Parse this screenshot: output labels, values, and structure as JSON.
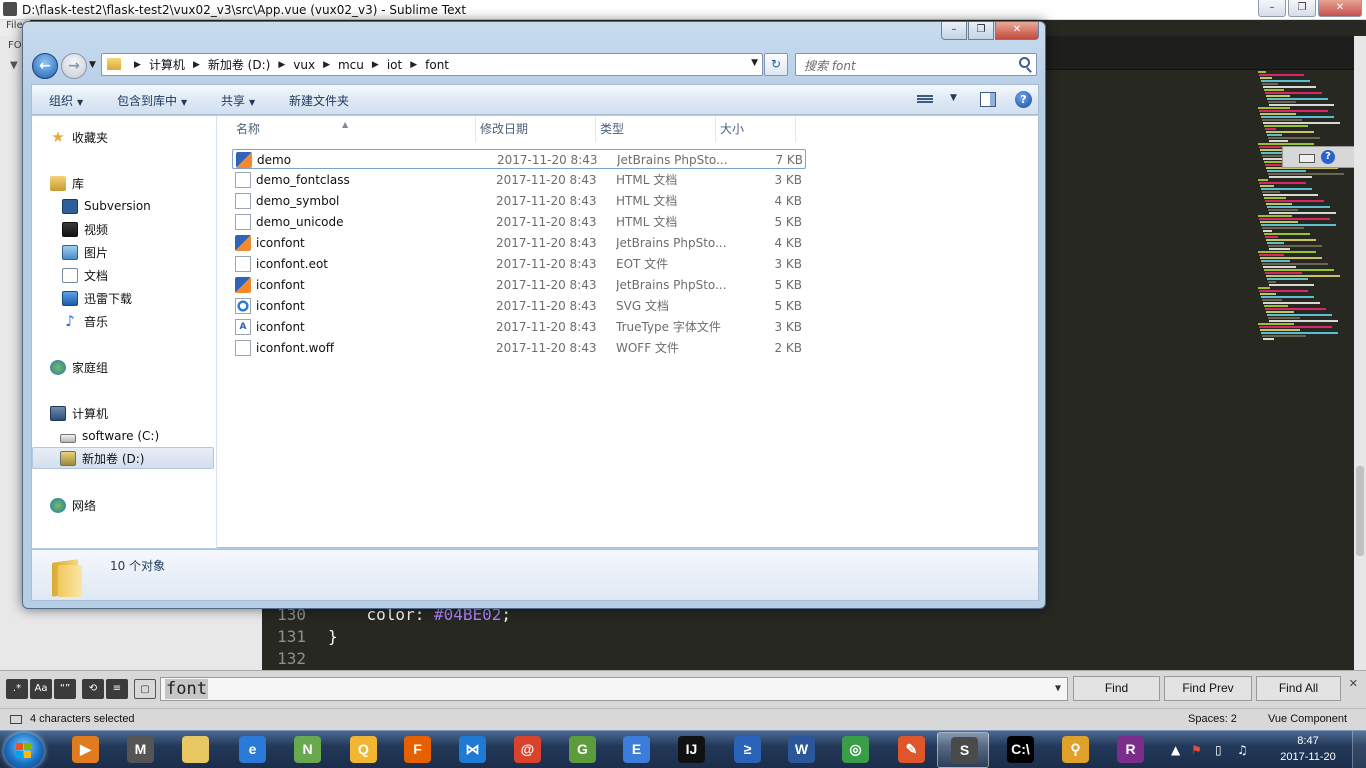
{
  "sublime": {
    "window_title": "D:\\flask-test2\\flask-test2\\vux02_v3\\src\\App.vue (vux02_v3) - Sublime Text",
    "menu_fragment": "File",
    "sidebar_fragment": "FO",
    "code_lines": [
      {
        "num": "130",
        "prop": "    color: ",
        "value": "#04BE02",
        "end": ";"
      },
      {
        "num": "131",
        "prop": "}",
        "value": "",
        "end": ""
      },
      {
        "num": "132",
        "prop": "",
        "value": "",
        "end": ""
      }
    ],
    "find": {
      "options": [
        ".*",
        "Aa",
        "“”",
        "wrap",
        "sel",
        "hl"
      ],
      "query": "font",
      "find_label": "Find",
      "find_prev_label": "Find Prev",
      "find_all_label": "Find All"
    },
    "status": {
      "selection": "4 characters selected",
      "spaces": "Spaces: 2",
      "syntax": "Vue Component"
    }
  },
  "explorer": {
    "breadcrumb": [
      "计算机",
      "新加卷 (D:)",
      "vux",
      "mcu",
      "iot",
      "font"
    ],
    "search_placeholder": "搜索 font",
    "commands": {
      "organize": "组织",
      "include_library": "包含到库中",
      "share": "共享",
      "new_folder": "新建文件夹"
    },
    "nav": {
      "favorites": "收藏夹",
      "libraries": "库",
      "lib_items": [
        "Subversion",
        "视频",
        "图片",
        "文档",
        "迅雷下载",
        "音乐"
      ],
      "homegroup": "家庭组",
      "computer": "计算机",
      "drives": [
        "software (C:)",
        "新加卷 (D:)"
      ],
      "network": "网络"
    },
    "columns": {
      "name": "名称",
      "modified": "修改日期",
      "type": "类型",
      "size": "大小"
    },
    "files": [
      {
        "name": "demo",
        "modified": "2017-11-20 8:43",
        "type": "JetBrains PhpSto...",
        "size": "7 KB",
        "icon": "php-icon"
      },
      {
        "name": "demo_fontclass",
        "modified": "2017-11-20 8:43",
        "type": "HTML 文档",
        "size": "3 KB",
        "icon": "html-icon"
      },
      {
        "name": "demo_symbol",
        "modified": "2017-11-20 8:43",
        "type": "HTML 文档",
        "size": "4 KB",
        "icon": "html-icon"
      },
      {
        "name": "demo_unicode",
        "modified": "2017-11-20 8:43",
        "type": "HTML 文档",
        "size": "5 KB",
        "icon": "html-icon"
      },
      {
        "name": "iconfont",
        "modified": "2017-11-20 8:43",
        "type": "JetBrains PhpSto...",
        "size": "4 KB",
        "icon": "php-icon"
      },
      {
        "name": "iconfont.eot",
        "modified": "2017-11-20 8:43",
        "type": "EOT 文件",
        "size": "3 KB",
        "icon": "eot-icon"
      },
      {
        "name": "iconfont",
        "modified": "2017-11-20 8:43",
        "type": "JetBrains PhpSto...",
        "size": "5 KB",
        "icon": "php-icon"
      },
      {
        "name": "iconfont",
        "modified": "2017-11-20 8:43",
        "type": "SVG 文档",
        "size": "5 KB",
        "icon": "svg-icon"
      },
      {
        "name": "iconfont",
        "modified": "2017-11-20 8:43",
        "type": "TrueType 字体文件",
        "size": "3 KB",
        "icon": "ttf-icon"
      },
      {
        "name": "iconfont.woff",
        "modified": "2017-11-20 8:43",
        "type": "WOFF 文件",
        "size": "2 KB",
        "icon": "woff-icon"
      }
    ],
    "item_count": "10 个对象"
  },
  "taskbar": {
    "apps": [
      {
        "name": "media-player",
        "glyph": "▶",
        "color": "#e07b1f"
      },
      {
        "name": "markdown-editor",
        "glyph": "M",
        "color": "#555555"
      },
      {
        "name": "file-explorer",
        "glyph": "",
        "color": "#e8c862"
      },
      {
        "name": "internet-explorer",
        "glyph": "e",
        "color": "#2a7ad8"
      },
      {
        "name": "notepad-plus",
        "glyph": "N",
        "color": "#6aa84f"
      },
      {
        "name": "qq",
        "glyph": "Q",
        "color": "#f2b632"
      },
      {
        "name": "firefox",
        "glyph": "F",
        "color": "#e66000"
      },
      {
        "name": "visual-studio-code",
        "glyph": "⋈",
        "color": "#1e7ad2"
      },
      {
        "name": "snail-app",
        "glyph": "@",
        "color": "#d9432e"
      },
      {
        "name": "gadget-app",
        "glyph": "G",
        "color": "#5c9c3c"
      },
      {
        "name": "xshell",
        "glyph": "E",
        "color": "#3b7dd8"
      },
      {
        "name": "intellij-idea",
        "glyph": "IJ",
        "color": "#111111"
      },
      {
        "name": "powershell",
        "glyph": "≥",
        "color": "#2b63b8"
      },
      {
        "name": "word",
        "glyph": "W",
        "color": "#2b579a"
      },
      {
        "name": "chrome",
        "glyph": "◎",
        "color": "#3a9d48"
      },
      {
        "name": "pen-app",
        "glyph": "✎",
        "color": "#e0562b"
      },
      {
        "name": "sublime-text",
        "glyph": "S",
        "color": "#4a4a4a"
      },
      {
        "name": "command-prompt",
        "glyph": "C:\\",
        "color": "#000000"
      },
      {
        "name": "search-app",
        "glyph": "⚲",
        "color": "#e0a12b"
      },
      {
        "name": "winrar",
        "glyph": "R",
        "color": "#7a2d8a"
      }
    ],
    "clock_time": "8:47",
    "clock_date": "2017-11-20"
  }
}
